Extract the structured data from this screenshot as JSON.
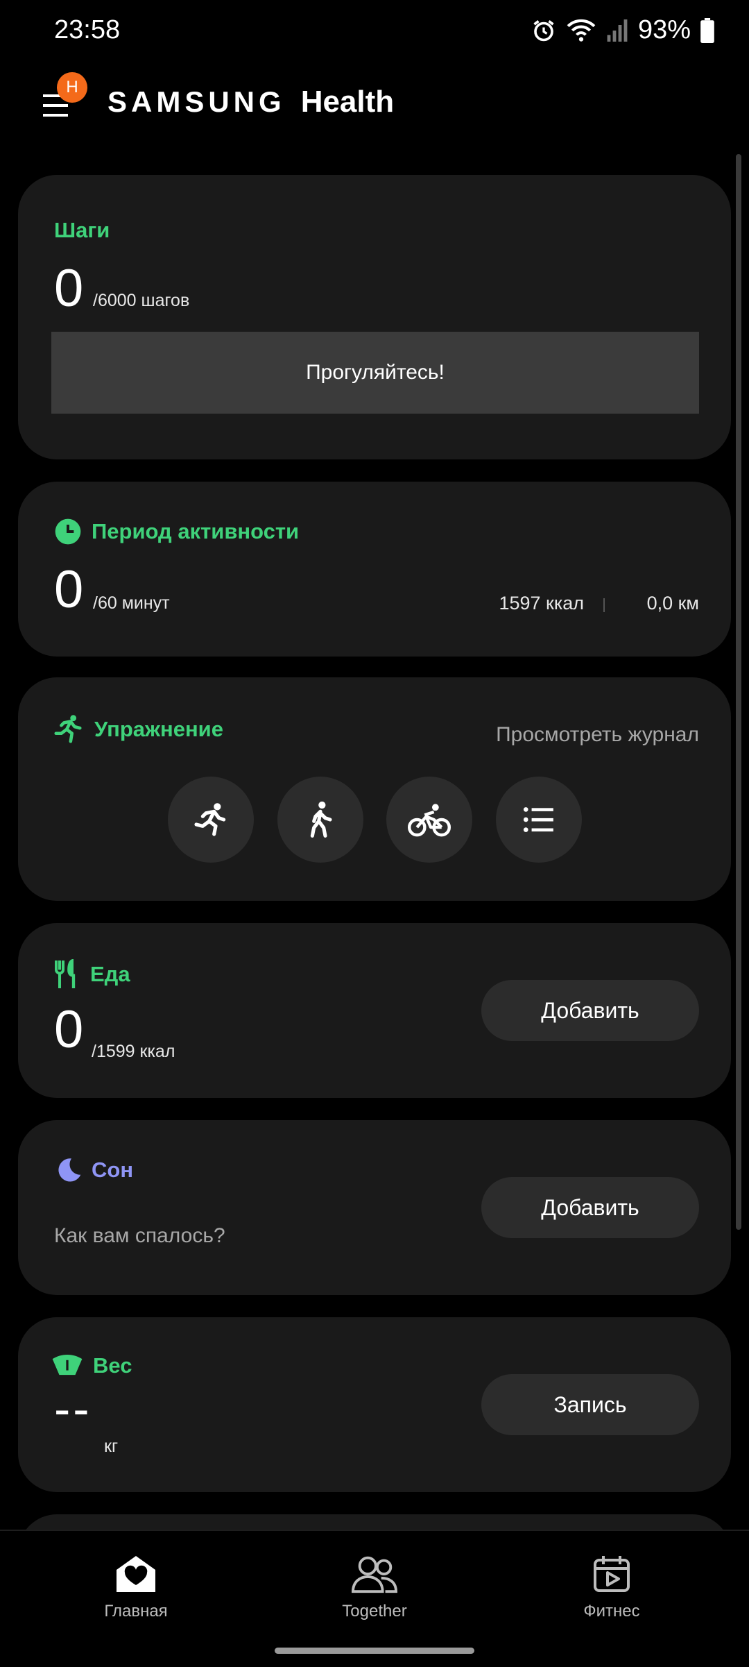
{
  "status_bar": {
    "time": "23:58",
    "battery": "93%"
  },
  "header": {
    "menu_badge": "H",
    "brand_samsung": "SAMSUNG",
    "brand_health": "Health"
  },
  "cards": {
    "steps": {
      "title": "Шаги",
      "value": "0",
      "target": "/6000 шагов",
      "cta": "Прогуляйтесь!"
    },
    "activity": {
      "title": "Период активности",
      "value": "0",
      "target": "/60 минут",
      "kcal": "1597 ккал",
      "distance": "0,0 км"
    },
    "exercise": {
      "title": "Упражнение",
      "link": "Просмотреть журнал"
    },
    "food": {
      "title": "Еда",
      "value": "0",
      "target": "/1599 ккал",
      "button": "Добавить"
    },
    "sleep": {
      "title": "Сон",
      "prompt": "Как вам спалось?",
      "button": "Добавить"
    },
    "weight": {
      "title": "Вес",
      "value": "--",
      "unit": "кг",
      "button": "Запись"
    }
  },
  "bottom_nav": {
    "home": "Главная",
    "together": "Together",
    "fitness": "Фитнес"
  },
  "colors": {
    "accent_green": "#3fd27a",
    "sleep_purple": "#8f95f5",
    "badge_orange": "#f46a1a"
  }
}
